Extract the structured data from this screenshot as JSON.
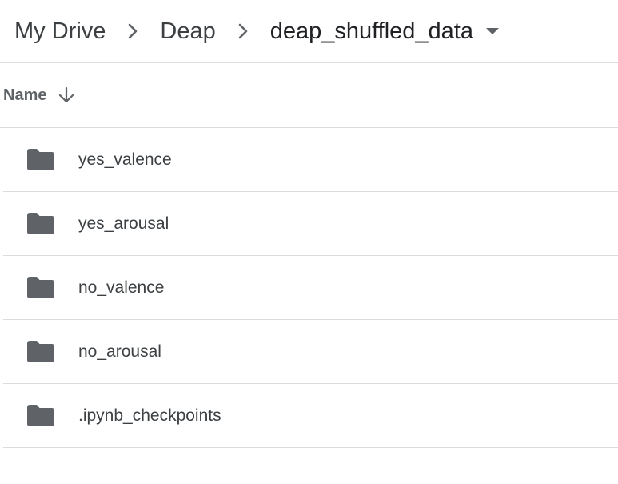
{
  "breadcrumb": {
    "items": [
      {
        "label": "My Drive"
      },
      {
        "label": "Deap"
      },
      {
        "label": "deap_shuffled_data"
      }
    ]
  },
  "list_header": {
    "name_label": "Name",
    "sort_icon": "arrow-down-icon"
  },
  "files": [
    {
      "name": "yes_valence",
      "icon": "folder-icon"
    },
    {
      "name": "yes_arousal",
      "icon": "folder-icon"
    },
    {
      "name": "no_valence",
      "icon": "folder-icon"
    },
    {
      "name": "no_arousal",
      "icon": "folder-icon"
    },
    {
      "name": ".ipynb_checkpoints",
      "icon": "folder-icon"
    }
  ],
  "colors": {
    "text": "#3c4043",
    "secondary": "#5f6368",
    "divider": "#dadce0",
    "icon": "#5f6368"
  }
}
